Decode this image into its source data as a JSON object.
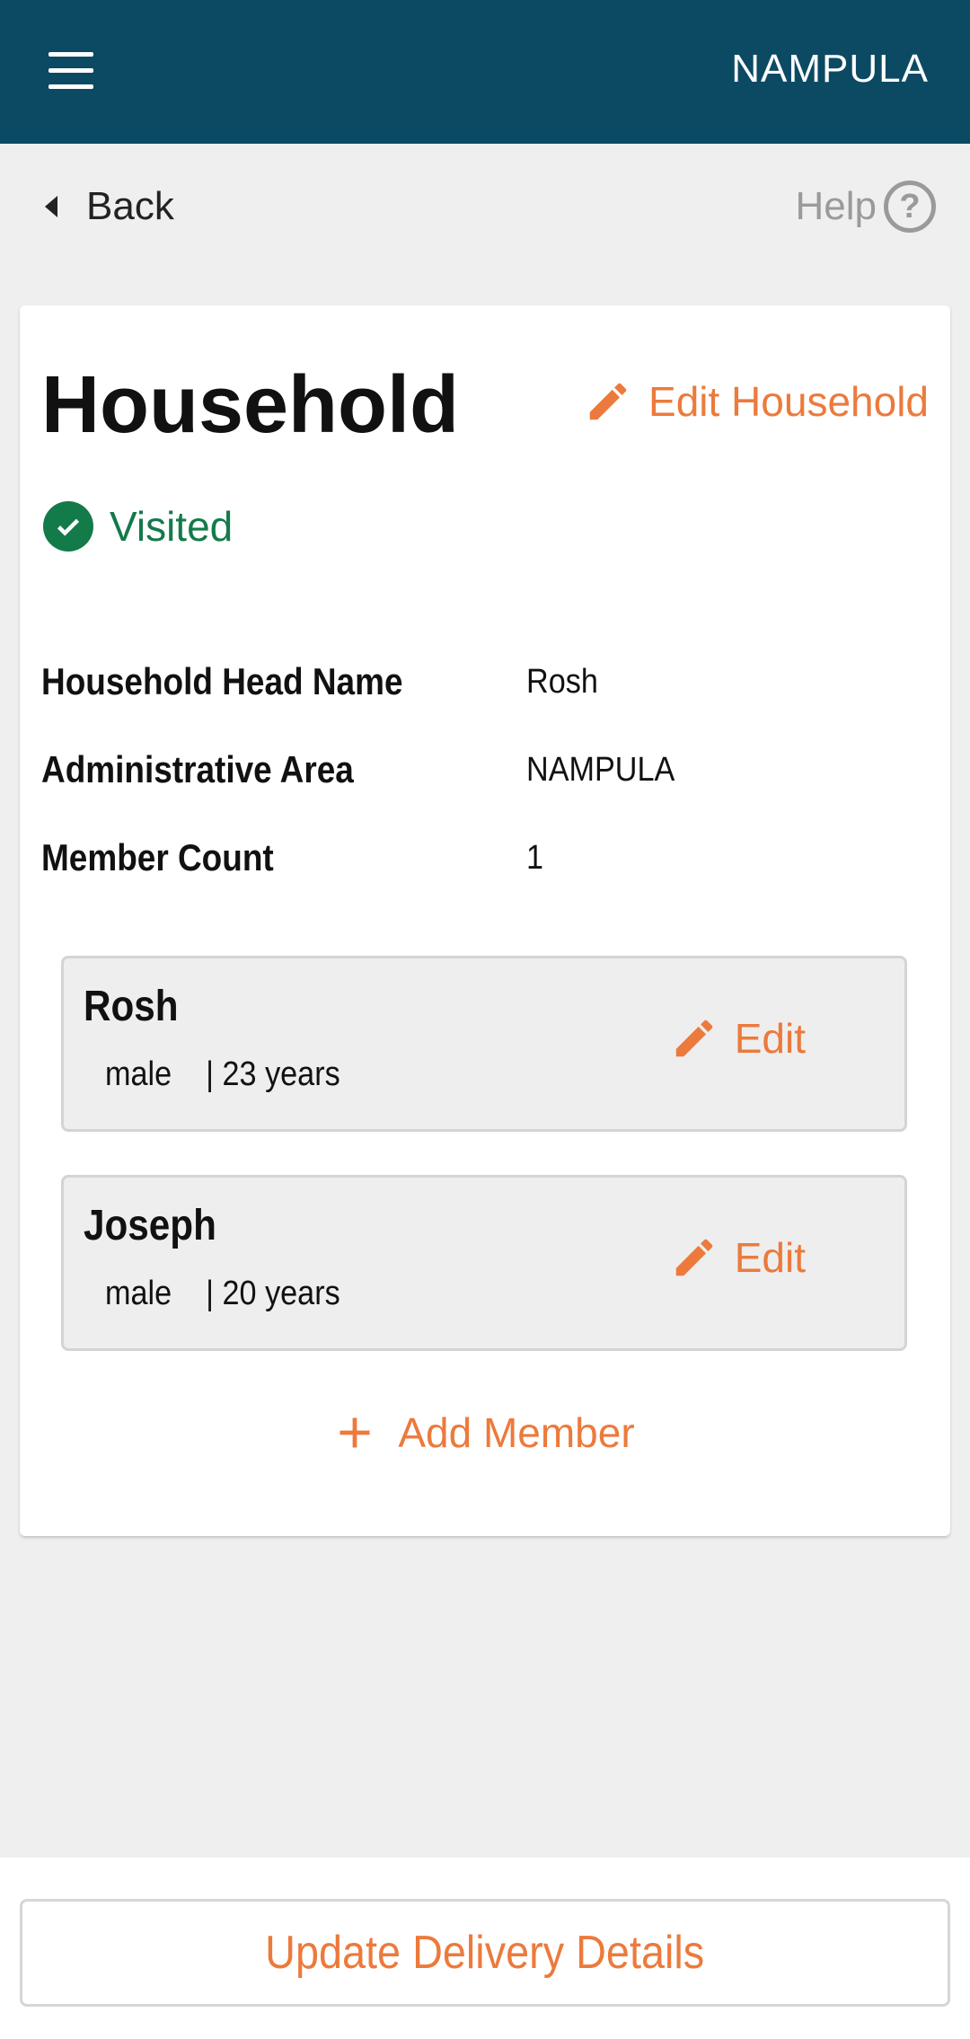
{
  "header": {
    "title": "NAMPULA",
    "menu_icon": "hamburger-menu-icon",
    "bg_color": "#0c4a64"
  },
  "nav": {
    "back_label": "Back",
    "help_label": "Help",
    "help_icon_glyph": "?"
  },
  "household": {
    "title": "Household",
    "edit_label": "Edit Household",
    "status": "Visited",
    "details": [
      {
        "label": "Household Head Name",
        "value": "Rosh"
      },
      {
        "label": "Administrative Area",
        "value": "NAMPULA"
      },
      {
        "label": "Member Count",
        "value": "1"
      }
    ],
    "members": [
      {
        "name": "Rosh",
        "meta": "male    | 23 years",
        "edit_label": "Edit"
      },
      {
        "name": "Joseph",
        "meta": "male    | 20 years",
        "edit_label": "Edit"
      }
    ],
    "add_member_label": "Add Member"
  },
  "footer": {
    "update_label": "Update Delivery Details"
  },
  "colors": {
    "accent": "#ec7a3c",
    "success": "#137a4a",
    "header": "#0c4a64"
  }
}
